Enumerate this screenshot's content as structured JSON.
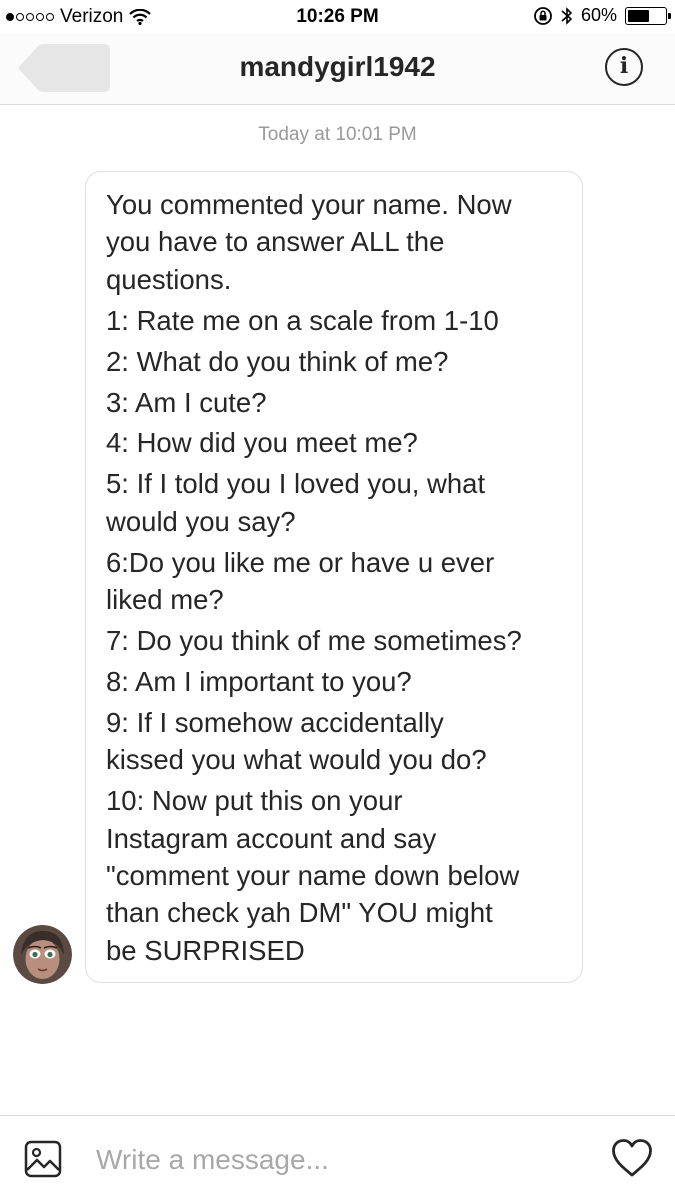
{
  "status_bar": {
    "signal_dots": 5,
    "signal_filled": 1,
    "carrier": "Verizon",
    "time": "10:26 PM",
    "battery": "60%",
    "battery_level": 0.6
  },
  "header": {
    "title": "mandygirl1942",
    "back_icon": "back-arrow-icon",
    "info_icon": "info-icon"
  },
  "thread": {
    "timestamp": "Today at 10:01 PM",
    "message": {
      "lines": [
        "You commented your name. Now",
        "you have to answer ALL the",
        "questions.",
        "1: Rate me on a scale from 1-10",
        "2: What do you think of me?",
        "3: Am I cute?",
        "4: How did you meet me?",
        "5: If I told you I loved you, what",
        "would you say?",
        "6:Do you like me or have u ever",
        "liked me?",
        "7: Do you think of me sometimes?",
        "8: Am I important to you?",
        "9: If I somehow accidentally",
        "kissed you what would you do?",
        "10: Now put this on your",
        "Instagram account and say",
        "\"comment your name down below",
        "than check yah DM\" YOU might",
        "be SURPRISED"
      ]
    }
  },
  "composer": {
    "placeholder": "Write a message...",
    "gallery_icon": "image-icon",
    "like_icon": "heart-icon"
  },
  "colors": {
    "text": "#262626",
    "timestamp": "#999999",
    "border": "#dbdbdb",
    "placeholder": "#a8a8a8"
  }
}
